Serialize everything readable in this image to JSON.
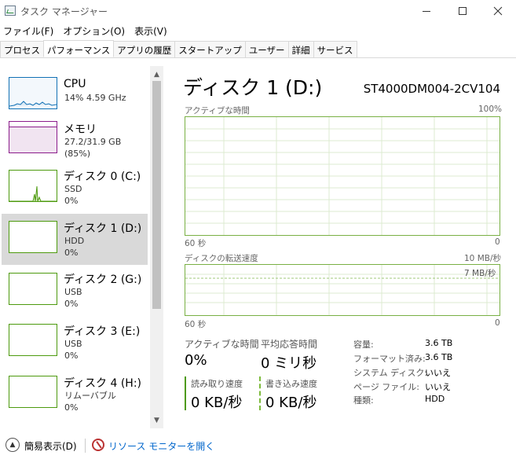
{
  "window": {
    "title": "タスク マネージャー"
  },
  "menu": [
    "ファイル(F)",
    "オプション(O)",
    "表示(V)"
  ],
  "tabs": [
    {
      "label": "プロセス",
      "active": false
    },
    {
      "label": "パフォーマンス",
      "active": true
    },
    {
      "label": "アプリの履歴",
      "active": false
    },
    {
      "label": "スタートアップ",
      "active": false
    },
    {
      "label": "ユーザー",
      "active": false
    },
    {
      "label": "詳細",
      "active": false
    },
    {
      "label": "サービス",
      "active": false
    }
  ],
  "sidebar": {
    "items": [
      {
        "title": "CPU",
        "line1": "14%  4.59 GHz",
        "line2": "",
        "color": "#1171b5",
        "fill": "#f3f8fc",
        "selected": false
      },
      {
        "title": "メモリ",
        "line1": "27.2/31.9 GB (85%)",
        "line2": "",
        "color": "#8b1c8b",
        "fill": "#f6eef6",
        "selected": false
      },
      {
        "title": "ディスク 0 (C:)",
        "line1": "SSD",
        "line2": "0%",
        "color": "#4d9a0e",
        "fill": "#ffffff",
        "selected": false
      },
      {
        "title": "ディスク 1 (D:)",
        "line1": "HDD",
        "line2": "0%",
        "color": "#4d9a0e",
        "fill": "#ffffff",
        "selected": true
      },
      {
        "title": "ディスク 2 (G:)",
        "line1": "USB",
        "line2": "0%",
        "color": "#4d9a0e",
        "fill": "#ffffff",
        "selected": false
      },
      {
        "title": "ディスク 3 (E:)",
        "line1": "USB",
        "line2": "0%",
        "color": "#4d9a0e",
        "fill": "#ffffff",
        "selected": false
      },
      {
        "title": "ディスク 4 (H:)",
        "line1": "リムーバブル",
        "line2": "0%",
        "color": "#4d9a0e",
        "fill": "#ffffff",
        "selected": false
      }
    ]
  },
  "main": {
    "title": "ディスク 1 (D:)",
    "model": "ST4000DM004-2CV104",
    "graph1": {
      "label": "アクティブな時間",
      "max": "100%",
      "xleft": "60 秒",
      "xright": "0"
    },
    "graph2": {
      "label": "ディスクの転送速度",
      "max": "10 MB/秒",
      "inner": "7 MB/秒",
      "xleft": "60 秒",
      "xright": "0"
    },
    "stats": {
      "active_label": "アクティブな時間",
      "active_value": "0%",
      "resp_label": "平均応答時間",
      "resp_value": "0 ミリ秒",
      "read_label": "読み取り速度",
      "read_value": "0 KB/秒",
      "write_label": "書き込み速度",
      "write_value": "0 KB/秒"
    },
    "props": [
      {
        "key": "容量:",
        "value": "3.6 TB"
      },
      {
        "key": "フォーマット済み:",
        "value": "3.6 TB"
      },
      {
        "key": "システム ディスク:",
        "value": "いいえ"
      },
      {
        "key": "ページ ファイル:",
        "value": "いいえ"
      },
      {
        "key": "種類:",
        "value": "HDD"
      }
    ]
  },
  "footer": {
    "simple_view": "簡易表示(D)",
    "resource_monitor": "リソース モニターを開く"
  },
  "colors": {
    "disk_green": "#79b044",
    "read_bar": "#4d9a0e",
    "write_bar": "#7dbb3c"
  }
}
